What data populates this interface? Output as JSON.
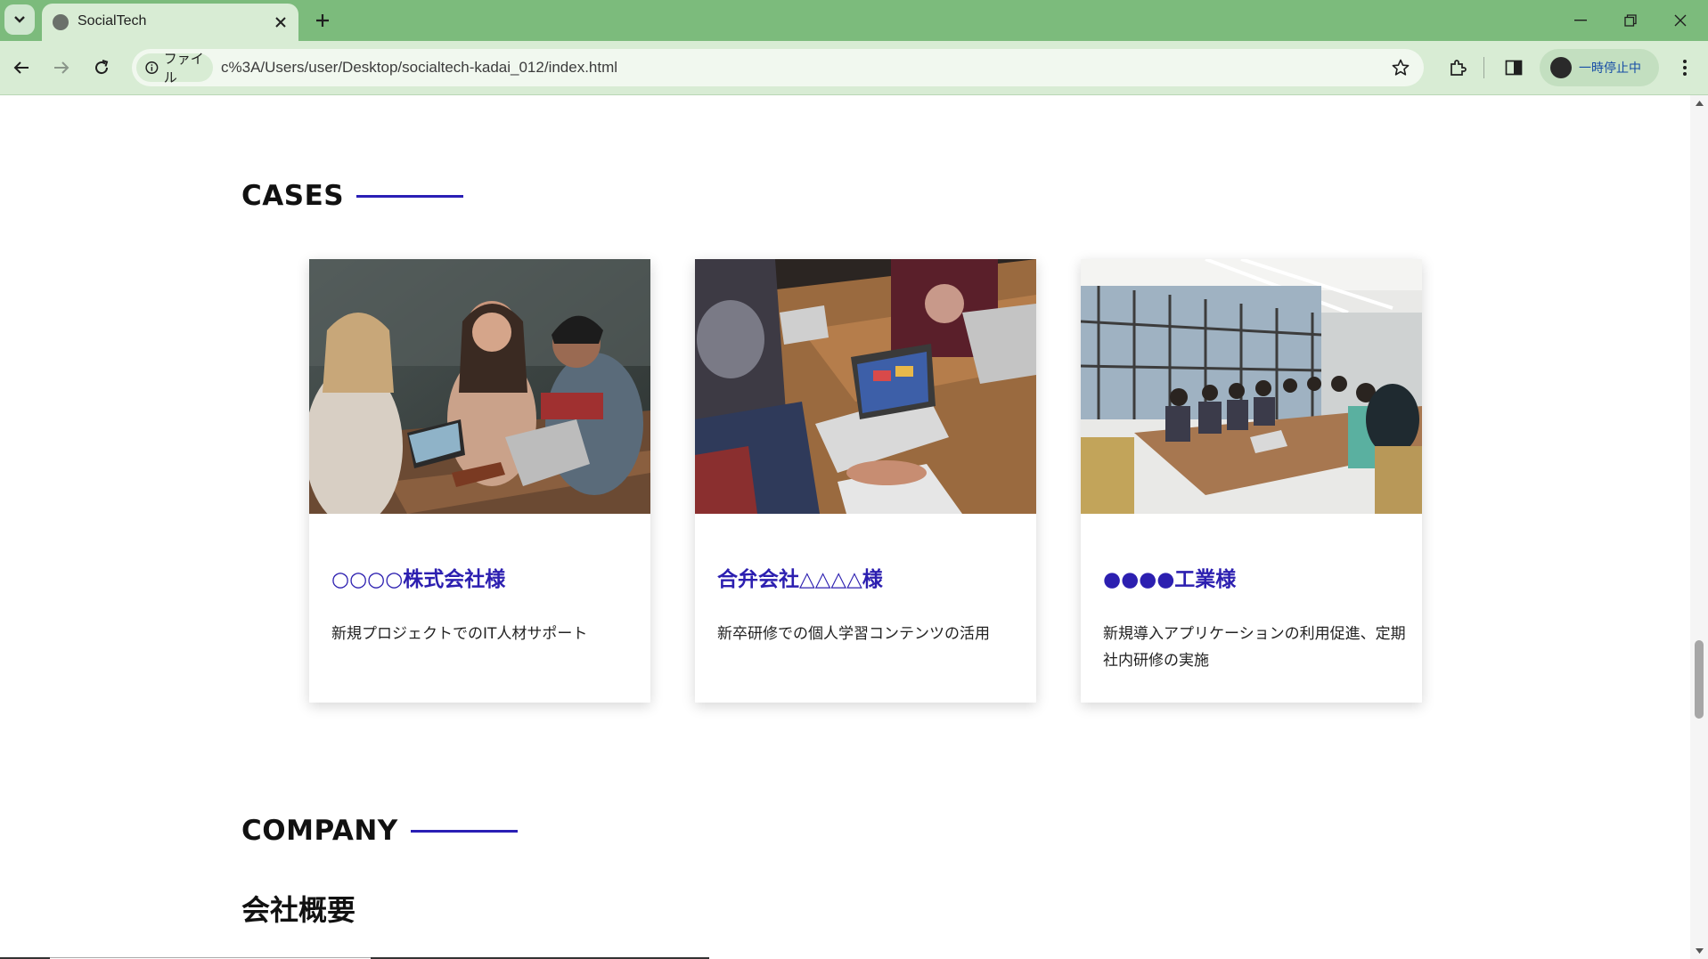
{
  "browser": {
    "tab_title": "SocialTech",
    "site_chip_label": "ファイル",
    "url": "c%3A/Users/user/Desktop/socialtech-kadai_012/index.html",
    "profile_label": "一時停止中"
  },
  "cases": {
    "heading": "CASES",
    "items": [
      {
        "title": "○○○○株式会社様",
        "description": "新規プロジェクトでのIT人材サポート"
      },
      {
        "title": "合弁会社△△△△様",
        "description": "新卒研修での個人学習コンテンツの活用"
      },
      {
        "title": "●●●●工業様",
        "description": "新規導入アプリケーションの利用促進、定期社内研修の実施"
      }
    ]
  },
  "company": {
    "heading": "COMPANY",
    "subheading": "会社概要"
  },
  "colors": {
    "chrome_green": "#7cbb7c",
    "accent_blue": "#2c1fb0"
  }
}
